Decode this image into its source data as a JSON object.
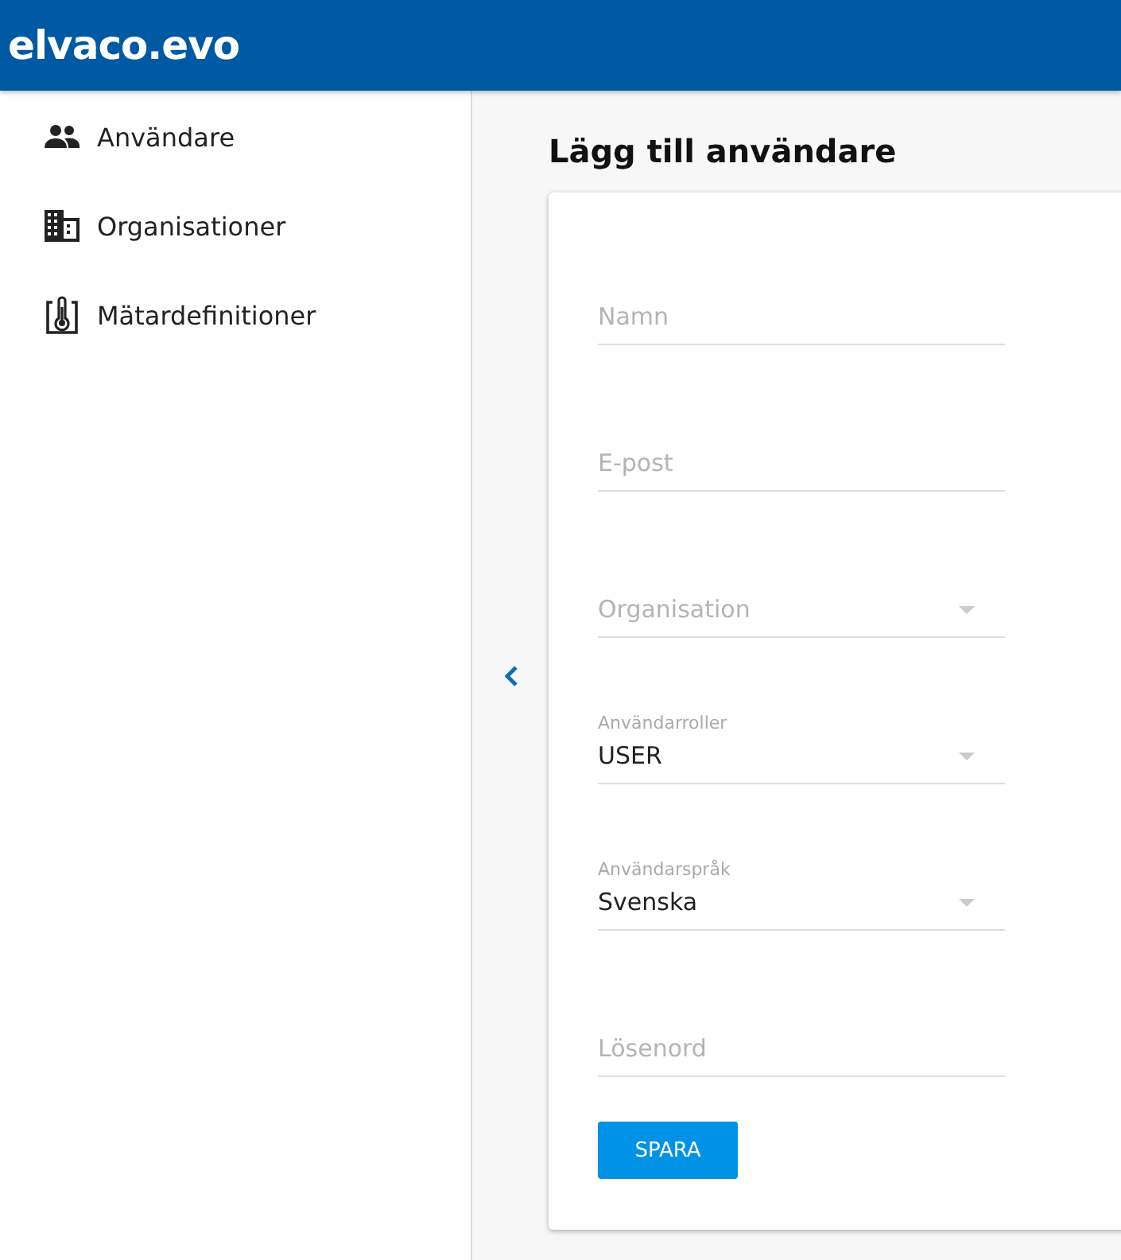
{
  "header": {
    "logo": "elvaco.evo"
  },
  "sidebar": {
    "items": [
      {
        "label": "Användare"
      },
      {
        "label": "Organisationer"
      },
      {
        "label": "Mätardefinitioner"
      }
    ]
  },
  "page": {
    "title": "Lägg till användare"
  },
  "form": {
    "fields": [
      {
        "kind": "text",
        "placeholder": "Namn"
      },
      {
        "kind": "text",
        "placeholder": "E-post"
      },
      {
        "kind": "select",
        "placeholder": "Organisation"
      },
      {
        "kind": "select",
        "label": "Användarroller",
        "value": "USER"
      },
      {
        "kind": "select",
        "label": "Användarspråk",
        "value": "Svenska"
      },
      {
        "kind": "password",
        "placeholder": "Lösenord"
      }
    ],
    "submit": "SPARA"
  }
}
